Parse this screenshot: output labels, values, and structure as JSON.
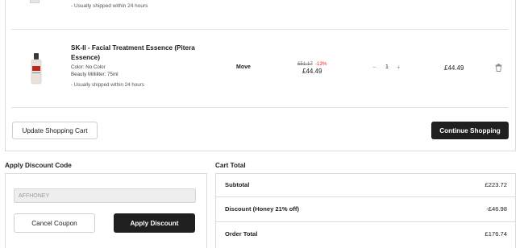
{
  "previous_item": {
    "shipping_note": "- Usually shipped within 24 hours"
  },
  "item": {
    "name": "SK-II - Facial Treatment Essence (Pitera Essence)",
    "color": "Color: No Color",
    "size": "Beauty Milliliter: 75ml",
    "shipping_note": "- Usually shipped within 24 hours",
    "move_label": "Move",
    "old_price": "£51.17",
    "discount_pct": "-13%",
    "price": "£44.49",
    "qty_minus": "−",
    "quantity": "1",
    "qty_plus": "+",
    "line_total": "£44.49",
    "delete_icon": "trash-icon"
  },
  "cart_actions": {
    "update_label": "Update Shopping Cart",
    "continue_label": "Continue Shopping"
  },
  "discount": {
    "title": "Apply Discount Code",
    "code_value": "AFFHONEY",
    "cancel_label": "Cancel Coupon",
    "apply_label": "Apply Discount"
  },
  "cart_total": {
    "title": "Cart Total",
    "rows": [
      {
        "label": "Subtotal",
        "value": "£223.72"
      },
      {
        "label": "Discount (Honey 21% off)",
        "value": "-£46.98"
      },
      {
        "label": "Order Total",
        "value": "£176.74"
      }
    ]
  },
  "colors": {
    "accent_dark": "#1f1f1f",
    "discount_red": "#d9262c"
  }
}
